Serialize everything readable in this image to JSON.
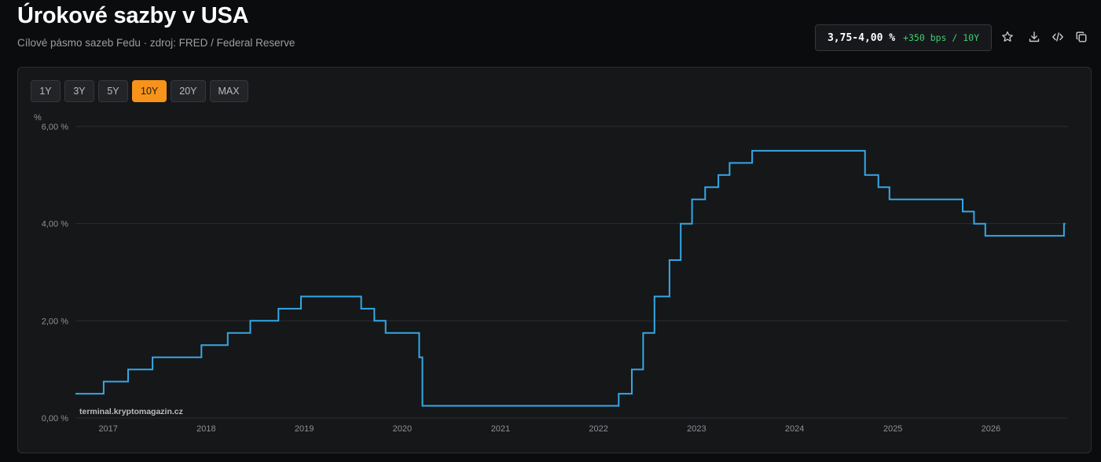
{
  "header": {
    "title": "Úrokové sazby v USA",
    "subtitle": "Cílové pásmo sazeb Fedu · zdroj: FRED / Federal Reserve"
  },
  "badge": {
    "value": "3,75-4,00 %",
    "change": "+350 bps / 10Y"
  },
  "toolbar": {
    "icons": [
      "star-icon",
      "download-icon",
      "embed-code-icon",
      "copy-icon"
    ]
  },
  "ranges": {
    "items": [
      "1Y",
      "3Y",
      "5Y",
      "10Y",
      "20Y",
      "MAX"
    ],
    "active": "10Y"
  },
  "colors": {
    "line": "#35a7e6",
    "accent": "#f7931a",
    "positive": "#3fcf6e"
  },
  "watermark": "terminal.kryptomagazin.cz",
  "chart_data": {
    "type": "line",
    "step": true,
    "ylabel": "%",
    "ylim": [
      0,
      6
    ],
    "yticks": [
      {
        "value": 0,
        "label": "0,00 %"
      },
      {
        "value": 2,
        "label": "2,00 %"
      },
      {
        "value": 4,
        "label": "4,00 %"
      },
      {
        "value": 6,
        "label": "6,00 %"
      }
    ],
    "xlim": [
      "2016-09-01",
      "2026-10-15"
    ],
    "xticks": [
      {
        "value": "2017-01-01",
        "label": "2017"
      },
      {
        "value": "2018-01-01",
        "label": "2018"
      },
      {
        "value": "2019-01-01",
        "label": "2019"
      },
      {
        "value": "2020-01-01",
        "label": "2020"
      },
      {
        "value": "2021-01-01",
        "label": "2021"
      },
      {
        "value": "2022-01-01",
        "label": "2022"
      },
      {
        "value": "2023-01-01",
        "label": "2023"
      },
      {
        "value": "2024-01-01",
        "label": "2024"
      },
      {
        "value": "2025-01-01",
        "label": "2025"
      },
      {
        "value": "2026-01-01",
        "label": "2026"
      }
    ],
    "grid": true,
    "series": [
      {
        "points": [
          [
            "2016-09-01",
            0.5
          ],
          [
            "2016-12-15",
            0.75
          ],
          [
            "2017-03-16",
            1.0
          ],
          [
            "2017-06-15",
            1.25
          ],
          [
            "2017-12-14",
            1.5
          ],
          [
            "2018-03-22",
            1.75
          ],
          [
            "2018-06-14",
            2.0
          ],
          [
            "2018-09-27",
            2.25
          ],
          [
            "2018-12-20",
            2.5
          ],
          [
            "2019-08-01",
            2.25
          ],
          [
            "2019-09-19",
            2.0
          ],
          [
            "2019-10-31",
            1.75
          ],
          [
            "2020-03-04",
            1.25
          ],
          [
            "2020-03-16",
            0.25
          ],
          [
            "2022-03-17",
            0.5
          ],
          [
            "2022-05-05",
            1.0
          ],
          [
            "2022-06-16",
            1.75
          ],
          [
            "2022-07-28",
            2.5
          ],
          [
            "2022-09-22",
            3.25
          ],
          [
            "2022-11-03",
            4.0
          ],
          [
            "2022-12-15",
            4.5
          ],
          [
            "2023-02-02",
            4.75
          ],
          [
            "2023-03-23",
            5.0
          ],
          [
            "2023-05-04",
            5.25
          ],
          [
            "2023-07-27",
            5.5
          ],
          [
            "2024-09-19",
            5.0
          ],
          [
            "2024-11-08",
            4.75
          ],
          [
            "2024-12-19",
            4.5
          ],
          [
            "2025-09-18",
            4.25
          ],
          [
            "2025-10-30",
            4.0
          ],
          [
            "2025-12-11",
            3.75
          ],
          [
            "2026-09-30",
            4.0
          ],
          [
            "2026-10-05",
            4.0
          ]
        ]
      }
    ]
  }
}
